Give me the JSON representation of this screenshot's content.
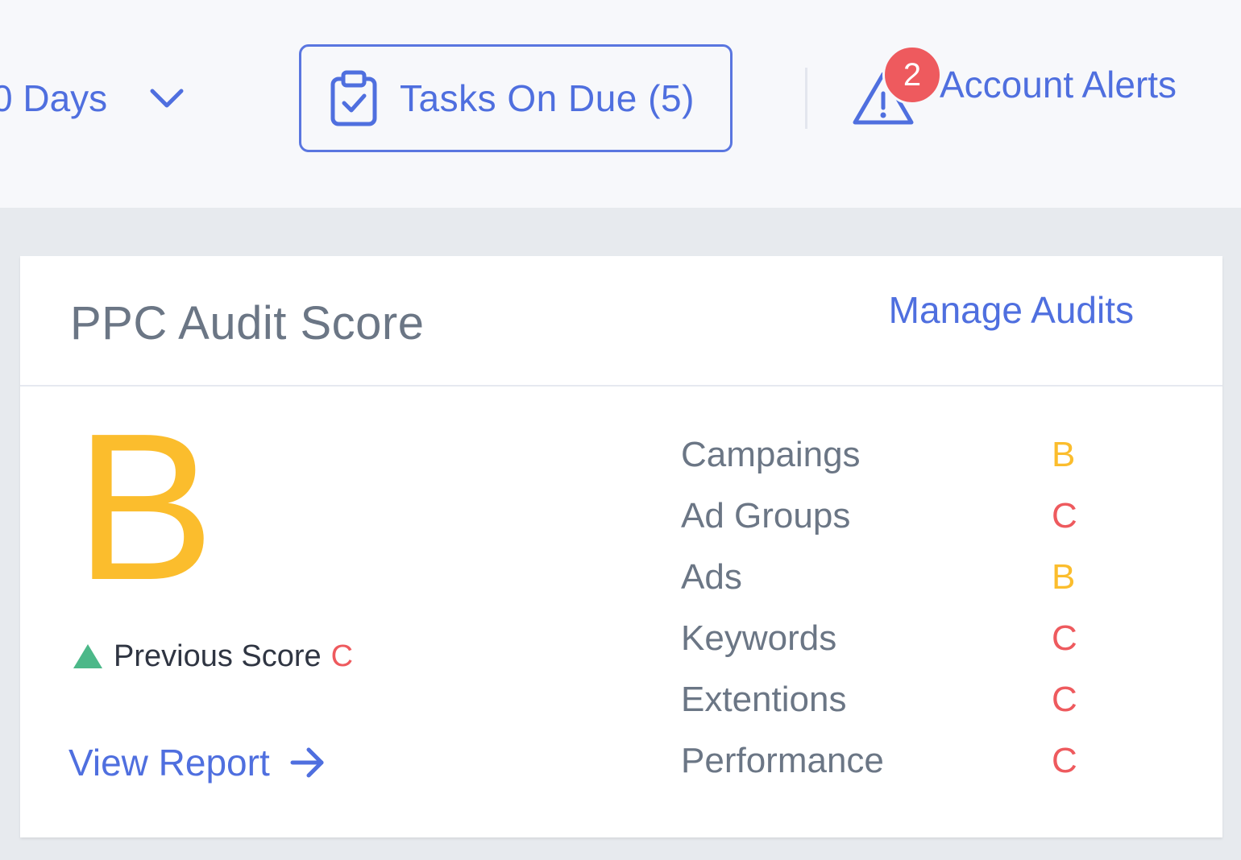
{
  "header": {
    "days_label": "0 Days",
    "tasks_label": "Tasks On Due (5)",
    "alerts_badge": "2",
    "alerts_label": "Account Alerts"
  },
  "card": {
    "title": "PPC Audit Score",
    "manage_label": "Manage Audits",
    "grade": "B",
    "previous_label": "Previous Score",
    "previous_grade": "C",
    "view_report_label": "View Report",
    "scores": [
      {
        "category": "Campaings",
        "grade": "B"
      },
      {
        "category": "Ad Groups",
        "grade": "C"
      },
      {
        "category": "Ads",
        "grade": "B"
      },
      {
        "category": "Keywords",
        "grade": "C"
      },
      {
        "category": "Extentions",
        "grade": "C"
      },
      {
        "category": "Performance",
        "grade": "C"
      }
    ]
  },
  "colors": {
    "accent": "#4f6fdf",
    "grade_b": "#fbbd2d",
    "grade_c": "#ee5a5e",
    "trend_up": "#4cb889"
  },
  "icons": {
    "days_dropdown": "chevron-down-icon",
    "tasks": "clipboard-check-icon",
    "alerts": "warning-triangle-icon",
    "previous_trend": "triangle-up-icon",
    "view_report": "arrow-right-icon"
  }
}
